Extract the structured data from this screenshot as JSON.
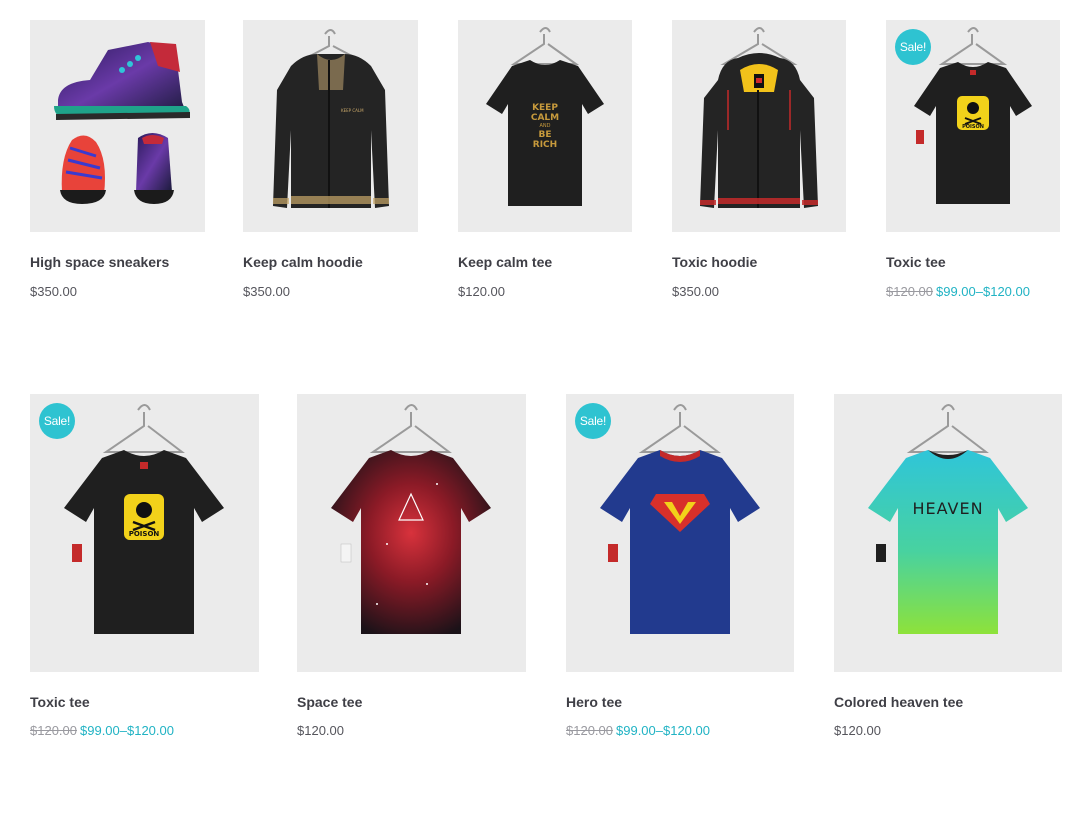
{
  "sale_label": "Sale!",
  "colors": {
    "accent": "#2ec3d1",
    "title": "#3f3f46",
    "price": "#55555c",
    "old_price": "#9a9aa0"
  },
  "products": [
    {
      "title": "High space sneakers",
      "price": "$350.00",
      "sale": false,
      "image": "sneakers-image"
    },
    {
      "title": "Keep calm hoodie",
      "price": "$350.00",
      "sale": false,
      "image": "hoodie-image"
    },
    {
      "title": "Keep calm tee",
      "price": "$120.00",
      "sale": false,
      "image": "tshirt-image",
      "print_text": [
        "KEEP",
        "CALM",
        "AND",
        "BE",
        "RICH"
      ]
    },
    {
      "title": "Toxic hoodie",
      "price": "$350.00",
      "sale": false,
      "image": "hoodie-image"
    },
    {
      "title": "Toxic tee",
      "old_price": "$120.00",
      "price_range": "$99.00–$120.00",
      "sale": true,
      "image": "tshirt-image",
      "print_text": [
        "POISON"
      ]
    },
    {
      "title": "Toxic tee",
      "old_price": "$120.00",
      "price_range": "$99.00–$120.00",
      "sale": true,
      "image": "tshirt-image",
      "print_text": [
        "POISON"
      ]
    },
    {
      "title": "Space tee",
      "price": "$120.00",
      "sale": false,
      "image": "tshirt-image"
    },
    {
      "title": "Hero tee",
      "old_price": "$120.00",
      "price_range": "$99.00–$120.00",
      "sale": true,
      "image": "tshirt-image"
    },
    {
      "title": "Colored heaven tee",
      "price": "$120.00",
      "sale": false,
      "image": "tshirt-image",
      "print_text": [
        "HEAVEN"
      ]
    }
  ]
}
